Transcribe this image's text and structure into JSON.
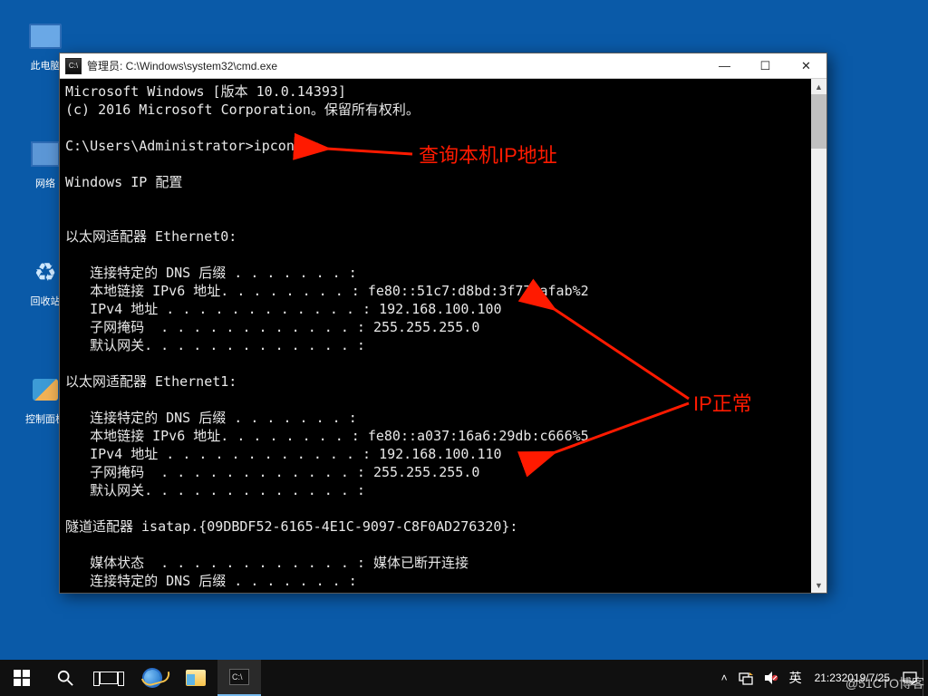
{
  "desktop": {
    "icons": [
      {
        "label": "此电脑"
      },
      {
        "label": "网络"
      },
      {
        "label": "回收站"
      },
      {
        "label": "控制面板"
      }
    ]
  },
  "cmd": {
    "title_prefix": "管理员: ",
    "title_path": "C:\\Windows\\system32\\cmd.exe",
    "app_icon_text": "C:\\",
    "lines": [
      "Microsoft Windows [版本 10.0.14393]",
      "(c) 2016 Microsoft Corporation。保留所有权利。",
      "",
      "C:\\Users\\Administrator>ipconfig",
      "",
      "Windows IP 配置",
      "",
      "",
      "以太网适配器 Ethernet0:",
      "",
      "   连接特定的 DNS 后缀 . . . . . . . :",
      "   本地链接 IPv6 地址. . . . . . . . : fe80::51c7:d8bd:3f77:afab%2",
      "   IPv4 地址 . . . . . . . . . . . . : 192.168.100.100",
      "   子网掩码  . . . . . . . . . . . . : 255.255.255.0",
      "   默认网关. . . . . . . . . . . . . :",
      "",
      "以太网适配器 Ethernet1:",
      "",
      "   连接特定的 DNS 后缀 . . . . . . . :",
      "   本地链接 IPv6 地址. . . . . . . . : fe80::a037:16a6:29db:c666%5",
      "   IPv4 地址 . . . . . . . . . . . . : 192.168.100.110",
      "   子网掩码  . . . . . . . . . . . . : 255.255.255.0",
      "   默认网关. . . . . . . . . . . . . :",
      "",
      "隧道适配器 isatap.{09DBDF52-6165-4E1C-9097-C8F0AD276320}:",
      "",
      "   媒体状态  . . . . . . . . . . . . : 媒体已断开连接",
      "   连接特定的 DNS 后缀 . . . . . . . :"
    ]
  },
  "annotations": {
    "query_ip": "查询本机IP地址",
    "ip_normal": "IP正常",
    "arrow_color": "#ff1a00"
  },
  "taskbar": {
    "ime": "英",
    "clock_time": "21:23",
    "clock_date": "2019/7/25",
    "tray_chevron": "˄"
  },
  "watermark": "@51CTO博客"
}
